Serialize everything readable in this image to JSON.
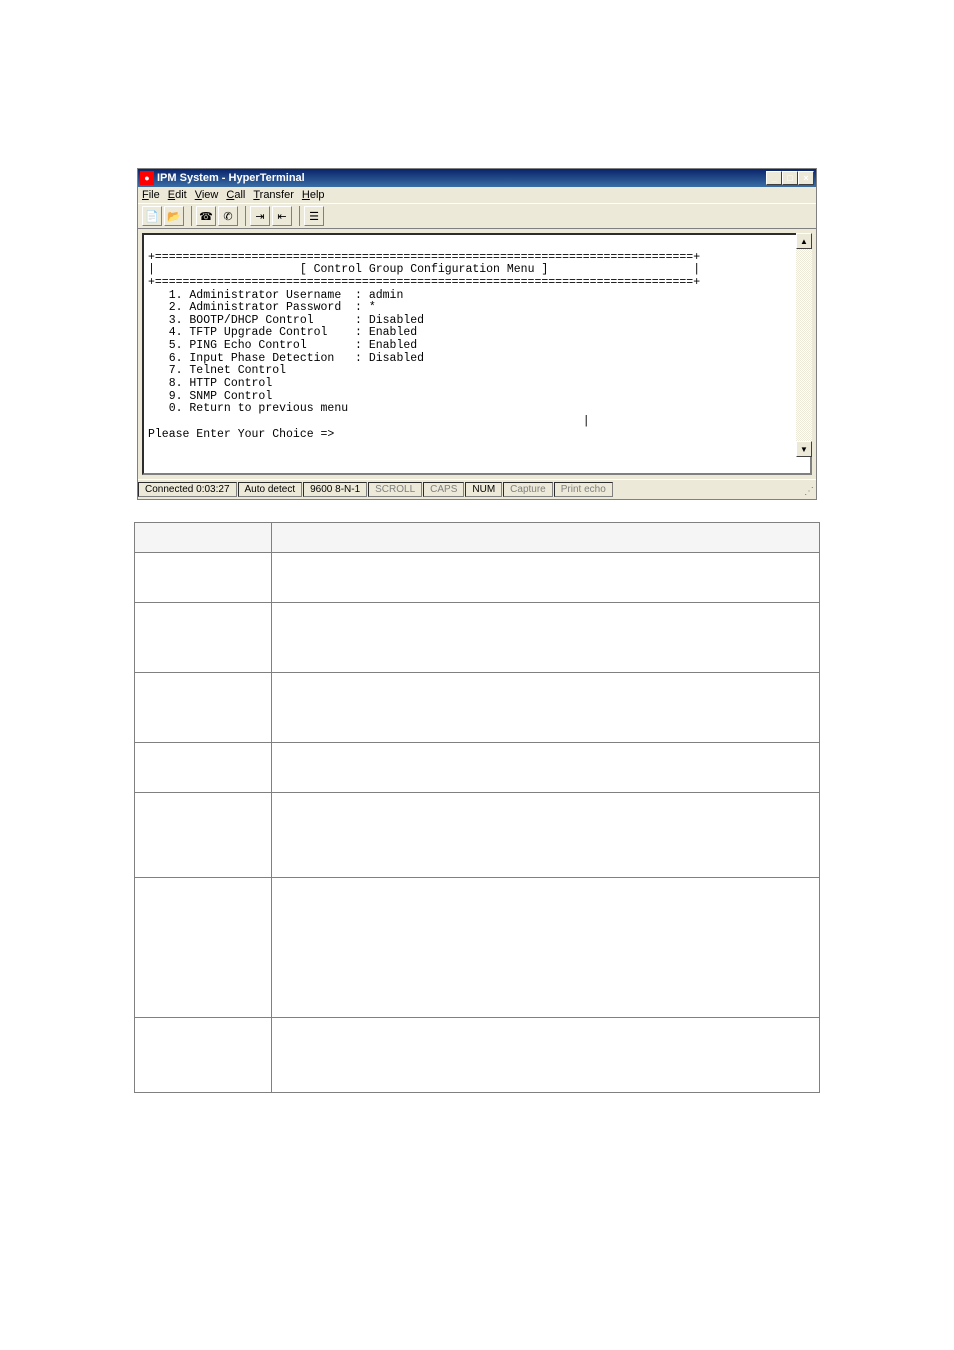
{
  "window": {
    "title": "IPM System - HyperTerminal",
    "minimize": "_",
    "maximize": "□",
    "close": "×"
  },
  "menubar": {
    "file": "File",
    "edit": "Edit",
    "view": "View",
    "call": "Call",
    "transfer": "Transfer",
    "help": "Help"
  },
  "terminal": {
    "header": "[ Control Group Configuration Menu ]",
    "line1": "   1. Administrator Username  : admin",
    "line2": "   2. Administrator Password  : *",
    "line3": "   3. BOOTP/DHCP Control      : Disabled",
    "line4": "   4. TFTP Upgrade Control    : Enabled",
    "line5": "   5. PING Echo Control       : Enabled",
    "line6": "   6. Input Phase Detection   : Disabled",
    "line7": "   7. Telnet Control",
    "line8": "   8. HTTP Control",
    "line9": "   9. SNMP Control",
    "line0": "   0. Return to previous menu",
    "prompt": "Please Enter Your Choice =>"
  },
  "statusbar": {
    "connected": "Connected 0:03:27",
    "autodetect": "Auto detect",
    "baud": "9600 8-N-1",
    "scroll": "SCROLL",
    "caps": "CAPS",
    "num": "NUM",
    "capture": "Capture",
    "printecho": "Print echo"
  },
  "table": {
    "rows": 8
  }
}
